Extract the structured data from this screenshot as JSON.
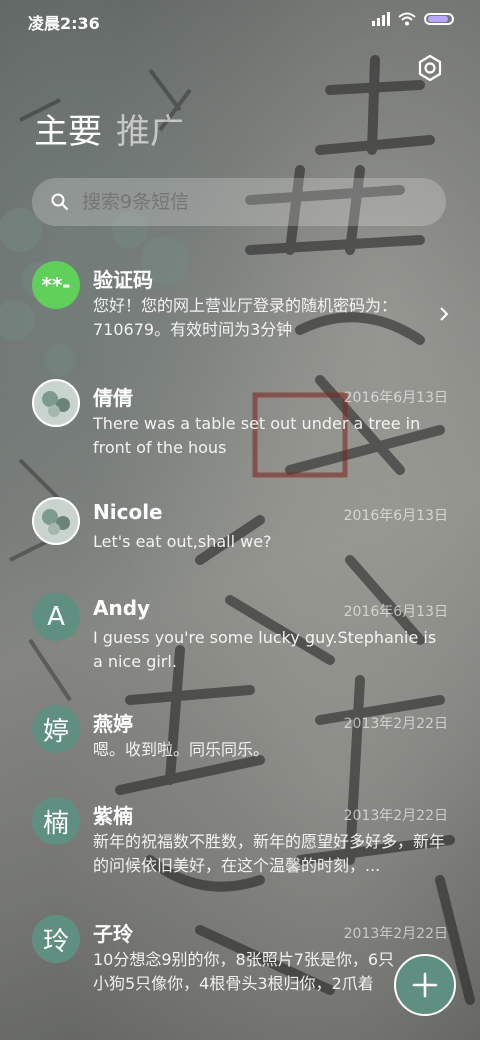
{
  "status_bar": {
    "time": "凌晨2:36"
  },
  "colors": {
    "avatar_green": "#5fd05a",
    "avatar_teal": "#5f8f80",
    "fab": "#5f8f80",
    "battery": "#b9a7ff"
  },
  "header": {
    "settings_icon": "gear-icon",
    "tabs": [
      {
        "label": "主要"
      },
      {
        "label": "推广"
      }
    ]
  },
  "search": {
    "placeholder": "搜索9条短信"
  },
  "conversations": [
    {
      "avatar_text": "**-",
      "name": "验证码",
      "date": "",
      "preview": "您好！您的网上营业厅登录的随机密码为：710679。有效时间为3分钟"
    },
    {
      "avatar_text": "",
      "name": "倩倩",
      "date": "2016年6月13日",
      "preview": "There was a table set out under a tree in front of the hous"
    },
    {
      "avatar_text": "",
      "name": "Nicole",
      "date": "2016年6月13日",
      "preview": "Let's eat out,shall we?"
    },
    {
      "avatar_text": "A",
      "name": "Andy",
      "date": "2016年6月13日",
      "preview": "I guess you're some lucky guy.Stephanie is a nice girl."
    },
    {
      "avatar_text": "婷",
      "name": "燕婷",
      "date": "2013年2月22日",
      "preview": "嗯。收到啦。同乐同乐。"
    },
    {
      "avatar_text": "楠",
      "name": "紫楠",
      "date": "2013年2月22日",
      "preview": "新年的祝福数不胜数，新年的愿望好多好多，新年的问候依旧美好，在这个温馨的时刻，..."
    },
    {
      "avatar_text": "玲",
      "name": "子玲",
      "date": "2013年2月22日",
      "preview": "10分想念9别的你，8张照片7张是你，6只小狗5只像你，4根骨头3根归你，2爪着地..."
    }
  ]
}
